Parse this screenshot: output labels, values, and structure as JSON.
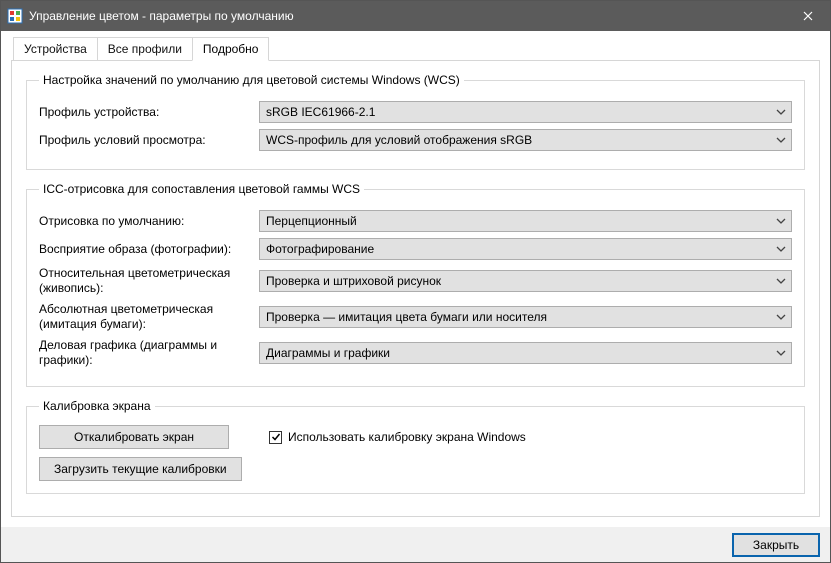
{
  "window": {
    "title": "Управление цветом - параметры по умолчанию"
  },
  "tabs": {
    "devices": "Устройства",
    "all_profiles": "Все профили",
    "details": "Подробно"
  },
  "group_wcs": {
    "legend": "Настройка значений по умолчанию для цветовой системы Windows (WCS)",
    "device_profile_label": "Профиль устройства:",
    "device_profile_value": "sRGB IEC61966-2.1",
    "viewing_conditions_label": "Профиль условий просмотра:",
    "viewing_conditions_value": "WCS-профиль для условий отображения sRGB"
  },
  "group_icc": {
    "legend": "ICC-отрисовка для сопоставления цветовой гаммы WCS",
    "default_rendering_label": "Отрисовка по умолчанию:",
    "default_rendering_value": "Перцепционный",
    "perceptual_label": "Восприятие образа (фотографии):",
    "perceptual_value": "Фотографирование",
    "relative_label": "Относительная цветометрическая (живопись):",
    "relative_value": "Проверка и штриховой рисунок",
    "absolute_label": "Абсолютная цветометрическая (имитация бумаги):",
    "absolute_value": "Проверка — имитация цвета бумаги или носителя",
    "business_label": "Деловая графика (диаграммы и графики):",
    "business_value": "Диаграммы и графики"
  },
  "group_calibration": {
    "legend": "Калибровка экрана",
    "calibrate_btn": "Откалибровать экран",
    "use_calibration_checkbox": "Использовать калибровку экрана Windows",
    "load_btn": "Загрузить текущие калибровки"
  },
  "footer": {
    "close": "Закрыть"
  }
}
